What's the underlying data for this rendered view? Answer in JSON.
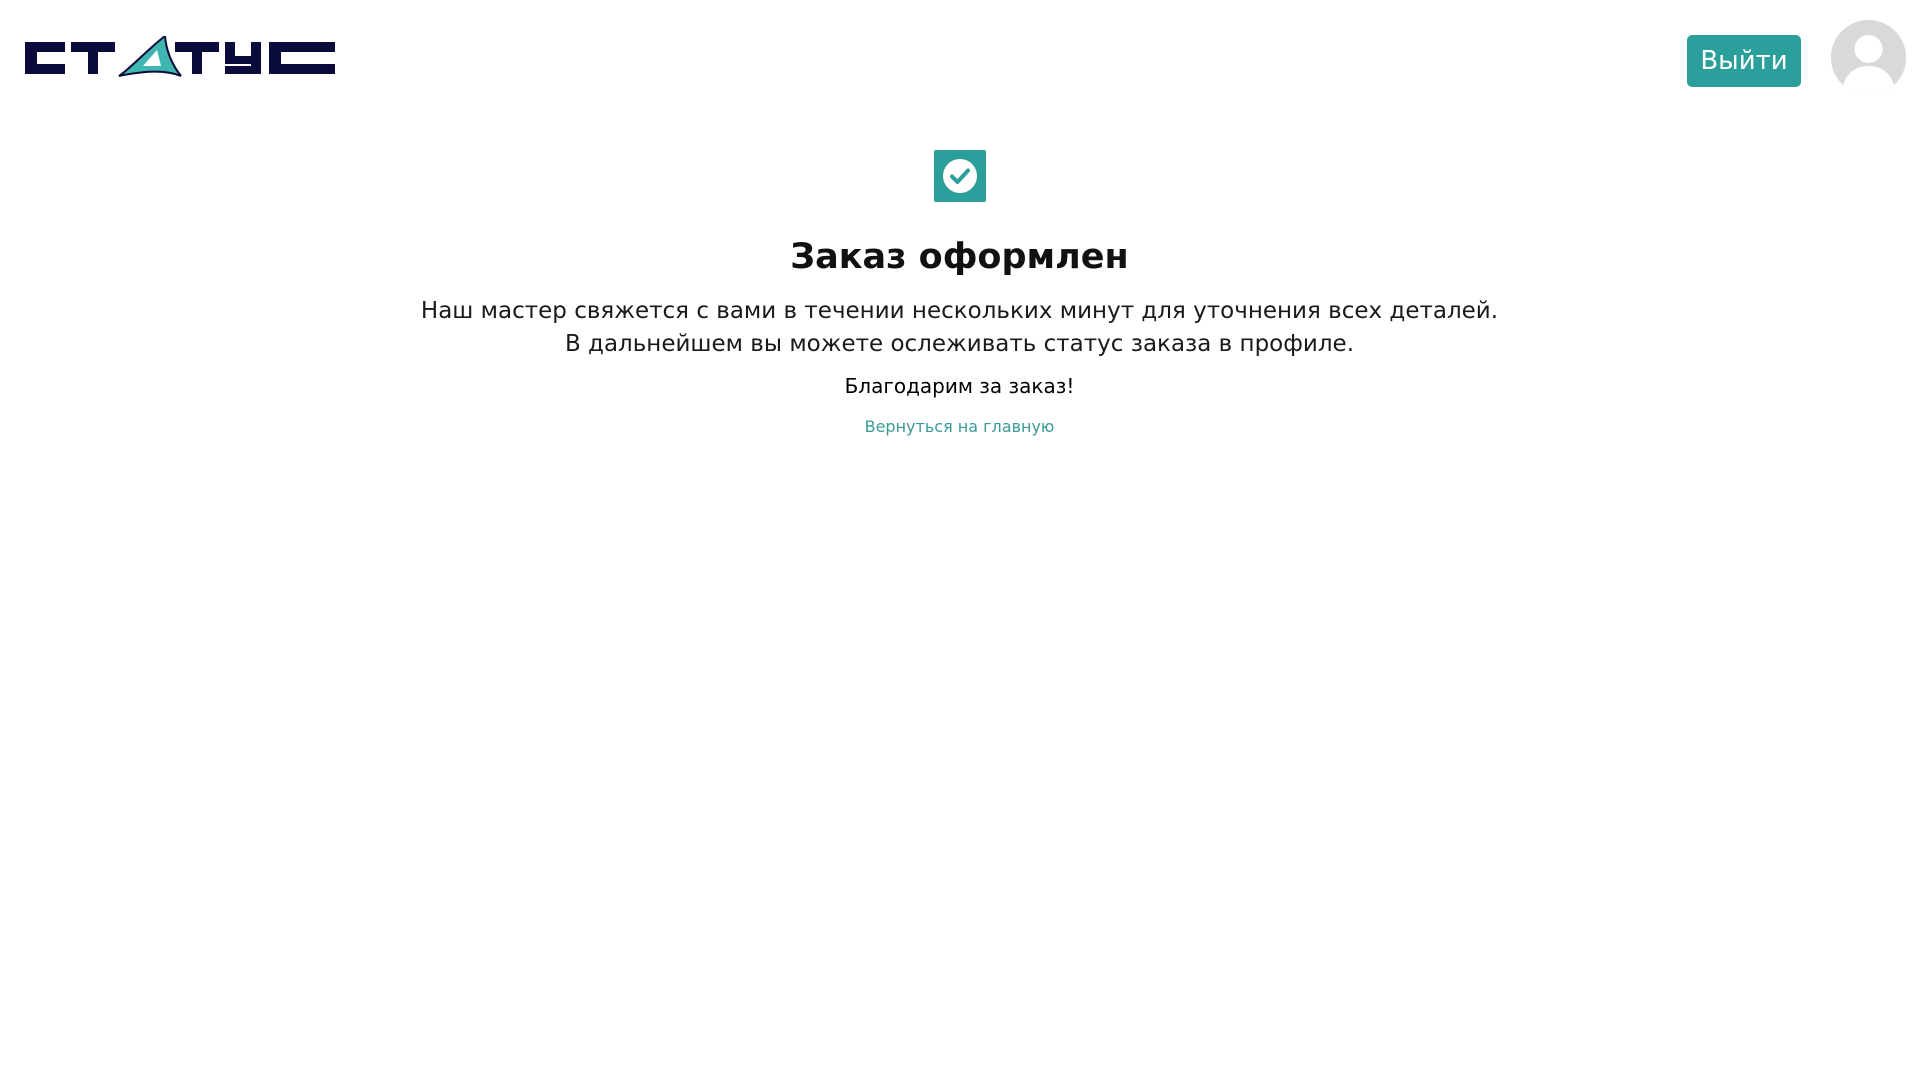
{
  "header": {
    "logo_text": "СТАТУС",
    "logout_label": "Выйти",
    "avatar_icon": "user-avatar-icon"
  },
  "main": {
    "status_icon": "check-circle-icon",
    "title": "Заказ оформлен",
    "message_line1": "Наш мастер свяжется с вами в течении нескольких минут для уточнения всех деталей.",
    "message_line2": "В дальнейшем вы можете ослеживать статус заказа в профиле.",
    "thanks": "Благодарим за заказ!",
    "home_link": "Вернуться на главную"
  },
  "colors": {
    "accent": "#2b9f9b",
    "logo_dark": "#0b0b3b",
    "logo_accent": "#3fb6b0",
    "avatar_bg": "#d9d9d9",
    "link": "#3a9a97"
  }
}
